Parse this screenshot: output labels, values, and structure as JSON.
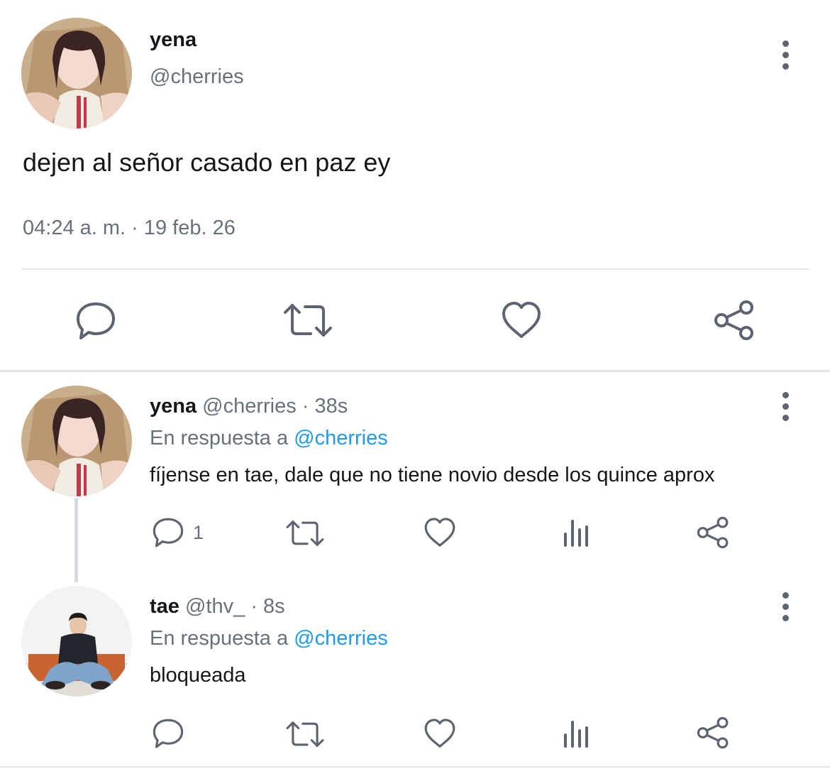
{
  "main_tweet": {
    "display_name": "yena",
    "handle": "@cherries",
    "text": "dejen al señor casado en paz ey",
    "timestamp": "04:24 a. m. · 19 feb. 26",
    "actions": [
      "reply-icon",
      "retweet-icon",
      "like-icon",
      "share-icon"
    ]
  },
  "replies": [
    {
      "display_name": "yena",
      "handle": "@cherries",
      "time": "· 38s",
      "reply_prefix": "En respuesta a",
      "reply_to": "@cherries",
      "text": "fíjense en tae, dale que no tiene novio desde los quince aprox",
      "reply_count": "1"
    },
    {
      "display_name": "tae",
      "handle": "@thv_",
      "time": "· 8s",
      "reply_prefix": "En respuesta a",
      "reply_to": "@cherries",
      "text": "bloqueada",
      "reply_count": ""
    }
  ],
  "colors": {
    "text": "#14171a",
    "muted": "#66717d",
    "link": "#1d9bf0",
    "icon": "#5b6470",
    "divider": "#e3e5e8"
  }
}
